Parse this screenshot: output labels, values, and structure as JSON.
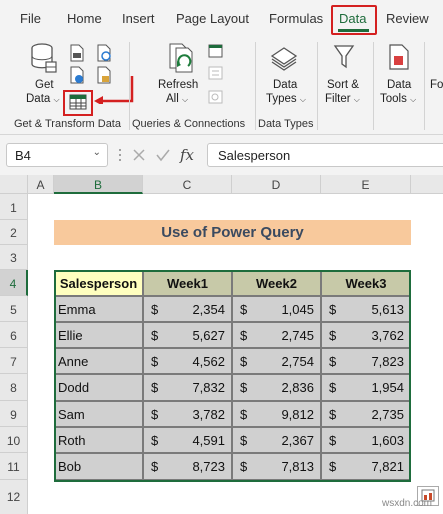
{
  "menu": {
    "tabs": [
      {
        "label": "File"
      },
      {
        "label": "Home"
      },
      {
        "label": "Insert"
      },
      {
        "label": "Page Layout"
      },
      {
        "label": "Formulas"
      },
      {
        "label": "Data"
      },
      {
        "label": "Review"
      }
    ],
    "active_tab": "Data"
  },
  "ribbon": {
    "get_data": {
      "line1": "Get",
      "line2": "Data"
    },
    "refresh_all": {
      "line1": "Refresh",
      "line2": "All"
    },
    "data_types": {
      "line1": "Data",
      "line2": "Types"
    },
    "sort_filter": {
      "line1": "Sort &",
      "line2": "Filter"
    },
    "data_tools": {
      "line1": "Data",
      "line2": "Tools"
    },
    "groups": [
      "Get & Transform Data",
      "Queries & Connections",
      "Data Types"
    ],
    "cut_group_label": "Fo"
  },
  "formula_bar": {
    "name_box": "B4",
    "fx": "fx",
    "content": "Salesperson"
  },
  "sheet": {
    "columns": [
      "A",
      "B",
      "C",
      "D",
      "E"
    ],
    "rows": [
      "1",
      "2",
      "3",
      "4",
      "5",
      "6",
      "7",
      "8",
      "9",
      "10",
      "11",
      "12"
    ],
    "title": "Use of Power Query",
    "table": {
      "headers": [
        "Salesperson",
        "Week1",
        "Week2",
        "Week3"
      ],
      "currency": "$",
      "rows": [
        {
          "name": "Emma",
          "w1": "2,354",
          "w2": "1,045",
          "w3": "5,613"
        },
        {
          "name": "Ellie",
          "w1": "5,627",
          "w2": "2,745",
          "w3": "3,762"
        },
        {
          "name": "Anne",
          "w1": "4,562",
          "w2": "2,754",
          "w3": "7,823"
        },
        {
          "name": "Dodd",
          "w1": "7,832",
          "w2": "2,836",
          "w3": "1,954"
        },
        {
          "name": "Sam",
          "w1": "3,782",
          "w2": "9,812",
          "w3": "2,735"
        },
        {
          "name": "Roth",
          "w1": "4,591",
          "w2": "2,367",
          "w3": "1,603"
        },
        {
          "name": "Bob",
          "w1": "8,723",
          "w2": "7,813",
          "w3": "7,821"
        }
      ]
    }
  },
  "watermark": "wsxdn.com",
  "colors": {
    "accent": "#1e6c3c",
    "highlight": "#d42020",
    "title_fill": "#f8c99c",
    "header_fill": "#c7c9a8",
    "salesperson_fill": "#ffffbf",
    "data_fill": "#d0d0d0"
  }
}
